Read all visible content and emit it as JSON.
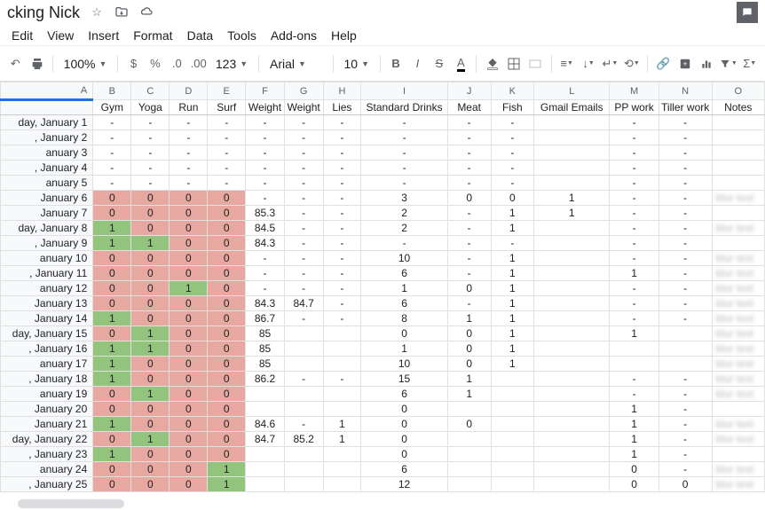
{
  "doc": {
    "title": "cking Nick"
  },
  "menus": [
    "Edit",
    "View",
    "Insert",
    "Format",
    "Data",
    "Tools",
    "Add-ons",
    "Help"
  ],
  "toolbar": {
    "zoom": "100%",
    "font": "Arial",
    "size": "10",
    "fmt123": "123"
  },
  "cols": [
    {
      "letter": "A",
      "label": "",
      "w": 105
    },
    {
      "letter": "B",
      "label": "Gym",
      "w": 44
    },
    {
      "letter": "C",
      "label": "Yoga",
      "w": 44
    },
    {
      "letter": "D",
      "label": "Run",
      "w": 44
    },
    {
      "letter": "E",
      "label": "Surf",
      "w": 44
    },
    {
      "letter": "F",
      "label": "Weight",
      "w": 44
    },
    {
      "letter": "G",
      "label": "Weight",
      "w": 44
    },
    {
      "letter": "H",
      "label": "Lies",
      "w": 44
    },
    {
      "letter": "I",
      "label": "Standard Drinks",
      "w": 98
    },
    {
      "letter": "J",
      "label": "Meat",
      "w": 50
    },
    {
      "letter": "K",
      "label": "Fish",
      "w": 50
    },
    {
      "letter": "L",
      "label": "Gmail Emails",
      "w": 86
    },
    {
      "letter": "M",
      "label": "PP work",
      "w": 56
    },
    {
      "letter": "N",
      "label": "Tiller work",
      "w": 60
    },
    {
      "letter": "O",
      "label": "Notes",
      "w": 60
    }
  ],
  "rows": [
    {
      "date": "day, January 1",
      "c": [
        "-",
        "-",
        "-",
        "-",
        "-",
        "-",
        "-",
        "-",
        "-",
        "-",
        "",
        "-",
        "-",
        ""
      ]
    },
    {
      "date": ", January 2",
      "c": [
        "-",
        "-",
        "-",
        "-",
        "-",
        "-",
        "-",
        "-",
        "-",
        "-",
        "",
        "-",
        "-",
        ""
      ]
    },
    {
      "date": "anuary 3",
      "c": [
        "-",
        "-",
        "-",
        "-",
        "-",
        "-",
        "-",
        "-",
        "-",
        "-",
        "",
        "-",
        "-",
        ""
      ]
    },
    {
      "date": ", January 4",
      "c": [
        "-",
        "-",
        "-",
        "-",
        "-",
        "-",
        "-",
        "-",
        "-",
        "-",
        "",
        "-",
        "-",
        ""
      ]
    },
    {
      "date": "anuary 5",
      "c": [
        "-",
        "-",
        "-",
        "-",
        "-",
        "-",
        "-",
        "-",
        "-",
        "-",
        "",
        "-",
        "-",
        ""
      ]
    },
    {
      "date": "January 6",
      "c": [
        "0",
        "0",
        "0",
        "0",
        "-",
        "-",
        "-",
        "3",
        "0",
        "0",
        "1",
        "-",
        "-",
        "blur"
      ],
      "cls": [
        "r",
        "r",
        "r",
        "r"
      ]
    },
    {
      "date": "January 7",
      "c": [
        "0",
        "0",
        "0",
        "0",
        "85.3",
        "-",
        "-",
        "2",
        "-",
        "1",
        "1",
        "-",
        "-",
        ""
      ],
      "cls": [
        "r",
        "r",
        "r",
        "r"
      ]
    },
    {
      "date": "day, January 8",
      "c": [
        "1",
        "0",
        "0",
        "0",
        "84.5",
        "-",
        "-",
        "2",
        "-",
        "1",
        "",
        "-",
        "-",
        "blur"
      ],
      "cls": [
        "g",
        "r",
        "r",
        "r"
      ]
    },
    {
      "date": ", January 9",
      "c": [
        "1",
        "1",
        "0",
        "0",
        "84.3",
        "-",
        "-",
        "-",
        "-",
        "-",
        "",
        "-",
        "-",
        ""
      ],
      "cls": [
        "g",
        "g",
        "r",
        "r"
      ]
    },
    {
      "date": "anuary 10",
      "c": [
        "0",
        "0",
        "0",
        "0",
        "-",
        "-",
        "-",
        "10",
        "-",
        "1",
        "",
        "-",
        "-",
        "blur"
      ],
      "cls": [
        "r",
        "r",
        "r",
        "r"
      ]
    },
    {
      "date": ", January 11",
      "c": [
        "0",
        "0",
        "0",
        "0",
        "-",
        "-",
        "-",
        "6",
        "-",
        "1",
        "",
        "1",
        "-",
        "blur"
      ],
      "cls": [
        "r",
        "r",
        "r",
        "r"
      ]
    },
    {
      "date": "anuary 12",
      "c": [
        "0",
        "0",
        "1",
        "0",
        "-",
        "-",
        "-",
        "1",
        "0",
        "1",
        "",
        "-",
        "-",
        "blur"
      ],
      "cls": [
        "r",
        "r",
        "g",
        "r"
      ]
    },
    {
      "date": "January 13",
      "c": [
        "0",
        "0",
        "0",
        "0",
        "84.3",
        "84.7",
        "-",
        "6",
        "-",
        "1",
        "",
        "-",
        "-",
        "blur"
      ],
      "cls": [
        "r",
        "r",
        "r",
        "r"
      ]
    },
    {
      "date": "January 14",
      "c": [
        "1",
        "0",
        "0",
        "0",
        "86.7",
        "-",
        "-",
        "8",
        "1",
        "1",
        "",
        "-",
        "-",
        "blur"
      ],
      "cls": [
        "g",
        "r",
        "r",
        "r"
      ]
    },
    {
      "date": "day, January 15",
      "c": [
        "0",
        "1",
        "0",
        "0",
        "85",
        "",
        "",
        "0",
        "0",
        "1",
        "",
        "1",
        "",
        "blur"
      ],
      "cls": [
        "r",
        "g",
        "r",
        "r"
      ]
    },
    {
      "date": ", January 16",
      "c": [
        "1",
        "1",
        "0",
        "0",
        "85",
        "",
        "",
        "1",
        "0",
        "1",
        "",
        "",
        "",
        "blur"
      ],
      "cls": [
        "g",
        "g",
        "r",
        "r"
      ]
    },
    {
      "date": "anuary 17",
      "c": [
        "1",
        "0",
        "0",
        "0",
        "85",
        "",
        "",
        "10",
        "0",
        "1",
        "",
        "",
        "",
        "blur"
      ],
      "cls": [
        "g",
        "r",
        "r",
        "r"
      ]
    },
    {
      "date": ", January 18",
      "c": [
        "1",
        "0",
        "0",
        "0",
        "86.2",
        "-",
        "-",
        "15",
        "1",
        "",
        "",
        "-",
        "-",
        "blur"
      ],
      "cls": [
        "g",
        "r",
        "r",
        "r"
      ]
    },
    {
      "date": "anuary 19",
      "c": [
        "0",
        "1",
        "0",
        "0",
        "",
        "",
        "",
        "6",
        "1",
        "",
        "",
        "-",
        "-",
        "blur"
      ],
      "cls": [
        "r",
        "g",
        "r",
        "r"
      ]
    },
    {
      "date": "January 20",
      "c": [
        "0",
        "0",
        "0",
        "0",
        "",
        "",
        "",
        "0",
        "",
        "",
        "",
        "1",
        "-",
        ""
      ],
      "cls": [
        "r",
        "r",
        "r",
        "r"
      ]
    },
    {
      "date": "January 21",
      "c": [
        "1",
        "0",
        "0",
        "0",
        "84.6",
        "-",
        "1",
        "0",
        "0",
        "",
        "",
        "1",
        "-",
        "blur"
      ],
      "cls": [
        "g",
        "r",
        "r",
        "r"
      ]
    },
    {
      "date": "day, January 22",
      "c": [
        "0",
        "1",
        "0",
        "0",
        "84.7",
        "85.2",
        "1",
        "0",
        "",
        "",
        "",
        "1",
        "-",
        "blur"
      ],
      "cls": [
        "r",
        "g",
        "r",
        "r"
      ]
    },
    {
      "date": ", January 23",
      "c": [
        "1",
        "0",
        "0",
        "0",
        "",
        "",
        "",
        "0",
        "",
        "",
        "",
        "1",
        "-",
        ""
      ],
      "cls": [
        "g",
        "r",
        "r",
        "r"
      ]
    },
    {
      "date": "anuary 24",
      "c": [
        "0",
        "0",
        "0",
        "1",
        "",
        "",
        "",
        "6",
        "",
        "",
        "",
        "0",
        "-",
        "blur"
      ],
      "cls": [
        "r",
        "r",
        "r",
        "g"
      ]
    },
    {
      "date": ", January 25",
      "c": [
        "0",
        "0",
        "0",
        "1",
        "",
        "",
        "",
        "12",
        "",
        "",
        "",
        "0",
        "0",
        "blur"
      ],
      "cls": [
        "r",
        "r",
        "r",
        "g"
      ]
    }
  ]
}
